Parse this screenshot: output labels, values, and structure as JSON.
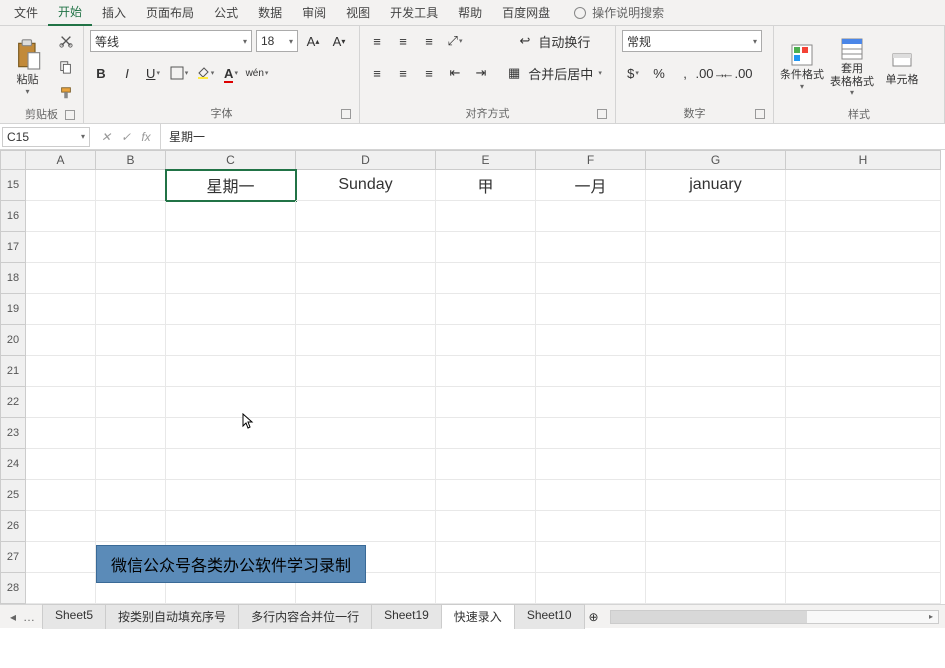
{
  "tabs": {
    "file": "文件",
    "home": "开始",
    "insert": "插入",
    "layout": "页面布局",
    "formulas": "公式",
    "data": "数据",
    "review": "审阅",
    "view": "视图",
    "dev": "开发工具",
    "help": "帮助",
    "baidu": "百度网盘",
    "tellme": "操作说明搜索"
  },
  "ribbon": {
    "clipboard": {
      "paste": "粘贴",
      "label": "剪贴板"
    },
    "font": {
      "name": "等线",
      "size": "18",
      "label": "字体"
    },
    "align": {
      "wrap": "自动换行",
      "merge": "合并后居中",
      "label": "对齐方式"
    },
    "number": {
      "format": "常规",
      "label": "数字"
    },
    "styles": {
      "cond": "条件格式",
      "table": "套用\n表格格式",
      "cell": "单元格",
      "label": "样式"
    }
  },
  "namebox": "C15",
  "formula": "星期一",
  "columns": [
    "A",
    "B",
    "C",
    "D",
    "E",
    "F",
    "G",
    "H"
  ],
  "row_start": 15,
  "row_count": 14,
  "data_row": {
    "C": "星期一",
    "D": "Sunday",
    "E": "甲",
    "F": "一月",
    "G": "january"
  },
  "banner": "微信公众号各类办公软件学习录制",
  "sheets": {
    "items": [
      "Sheet5",
      "按类别自动填充序号",
      "多行内容合并位一行",
      "Sheet19",
      "快速录入",
      "Sheet10"
    ],
    "active": "快速录入"
  }
}
